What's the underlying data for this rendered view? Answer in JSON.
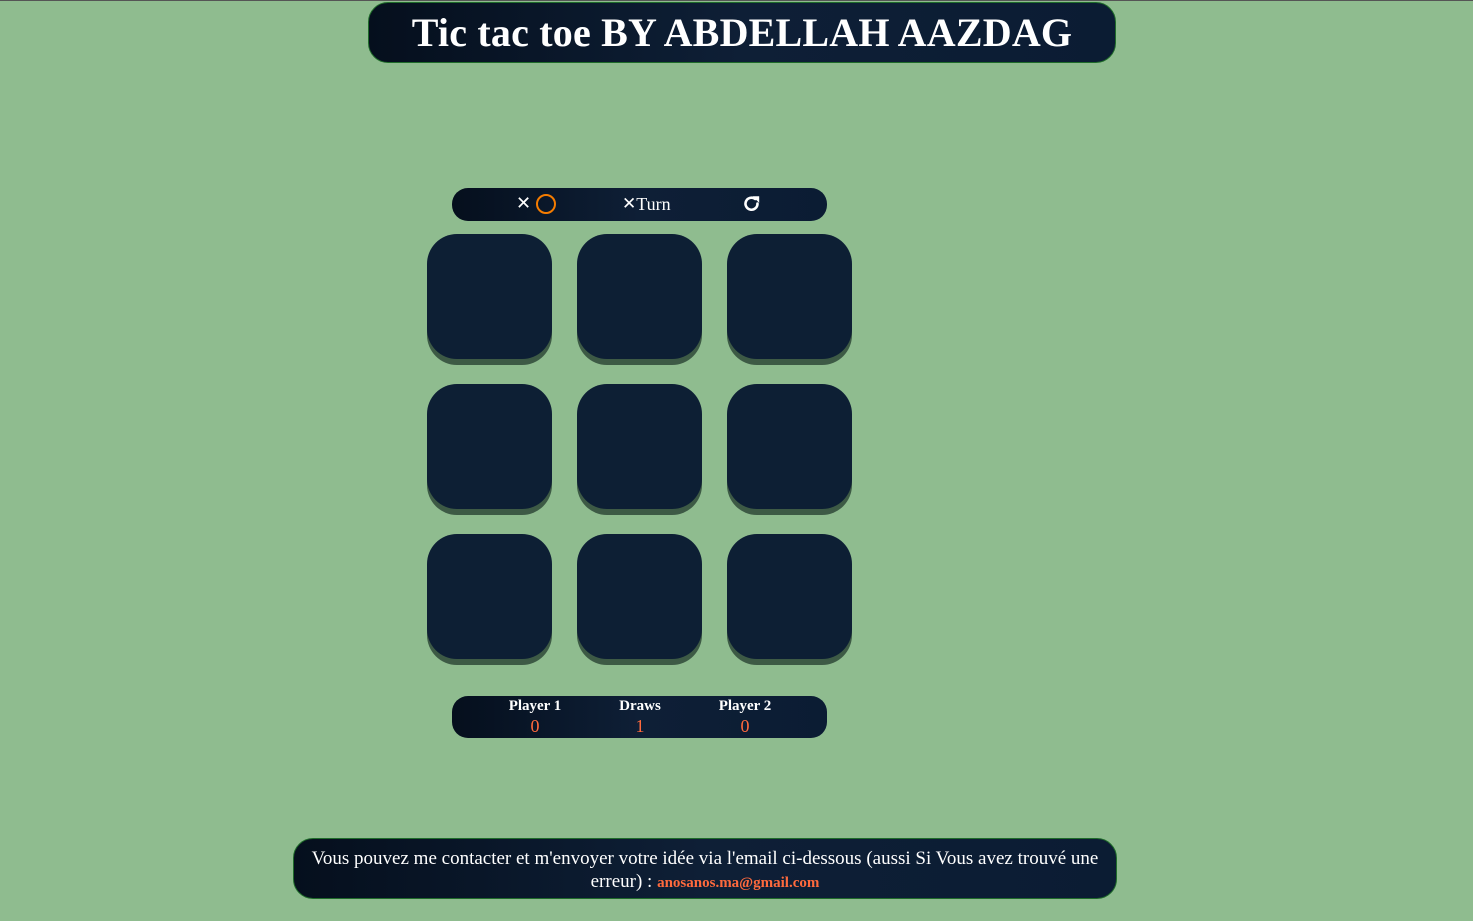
{
  "header": {
    "title": "Tic tac toe BY ABDELLAH AAZDAG"
  },
  "controls": {
    "x_symbol": "✕",
    "turn_symbol": "✕",
    "turn_label": "Turn",
    "restart_icon": "restart-icon",
    "o_color": "#f57c00"
  },
  "board": {
    "cells": [
      "",
      "",
      "",
      "",
      "",
      "",
      "",
      "",
      ""
    ]
  },
  "scores": {
    "player1_label": "Player 1",
    "player1_value": "0",
    "draws_label": "Draws",
    "draws_value": "1",
    "player2_label": "Player 2",
    "player2_value": "0"
  },
  "footer": {
    "message": "Vous pouvez me contacter et m'envoyer votre idée via l'email ci-dessous (aussi Si Vous avez trouvé une erreur) : ",
    "email": "anosanos.ma@gmail.com"
  },
  "colors": {
    "background": "#8fbc8f",
    "panel": "#0d1f34",
    "accent": "#ff6a3d"
  }
}
